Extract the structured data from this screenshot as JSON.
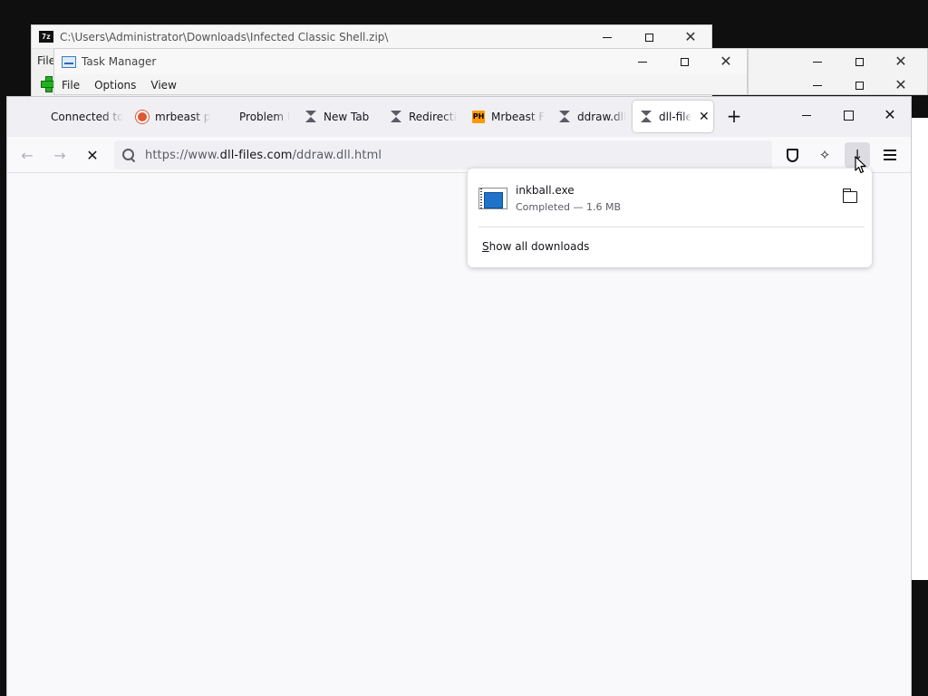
{
  "bg_windows": {
    "sevenzip": {
      "icon": "7z",
      "title": "C:\\Users\\Administrator\\Downloads\\Infected Classic Shell.zip\\",
      "menu_first": "File"
    },
    "task_manager": {
      "title": "Task Manager",
      "menu": [
        "File",
        "Options",
        "View"
      ]
    }
  },
  "browser": {
    "tabs": [
      {
        "label": "Connected to",
        "icon": "none",
        "active": false
      },
      {
        "label": "mrbeast p",
        "icon": "duckduckgo-icon",
        "active": false
      },
      {
        "label": "Problem l",
        "icon": "none",
        "active": false
      },
      {
        "label": "New Tab",
        "icon": "hourglass-icon",
        "active": false
      },
      {
        "label": "Redirecti",
        "icon": "hourglass-icon",
        "active": false
      },
      {
        "label": "Mrbeast F",
        "icon": "ph-icon",
        "active": false
      },
      {
        "label": "ddraw.dll",
        "icon": "hourglass-icon",
        "active": false
      },
      {
        "label": "dll-file",
        "icon": "hourglass-icon",
        "active": true
      }
    ],
    "ph_icon_text": "PH",
    "new_tab": "+",
    "url_prefix": "https://www.",
    "url_domain": "dll-files.com",
    "url_path": "/ddraw.dll.html",
    "downloads": {
      "items": [
        {
          "name": "inkball.exe",
          "status": "Completed — 1.6 MB"
        }
      ],
      "show_all_hotkey": "S",
      "show_all_rest": "how all downloads"
    }
  }
}
